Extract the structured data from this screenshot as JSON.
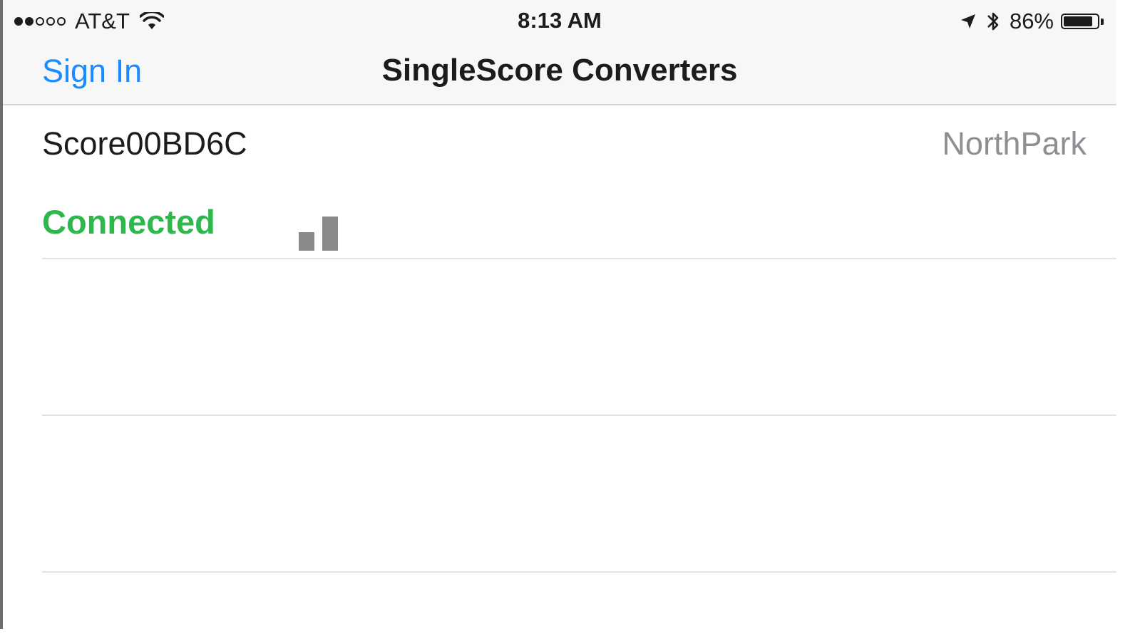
{
  "status_bar": {
    "signal_filled": 2,
    "signal_total": 5,
    "carrier": "AT&T",
    "time": "8:13 AM",
    "battery_percent": "86%",
    "battery_level": 0.86,
    "icons": [
      "wifi-icon",
      "location-arrow-icon",
      "bluetooth-icon",
      "battery-icon"
    ]
  },
  "nav": {
    "left_button": "Sign In",
    "title": "SingleScore Converters"
  },
  "devices": [
    {
      "name": "Score00BD6C",
      "location": "NorthPark",
      "status": "Connected",
      "signal_bars_visible": 2,
      "signal_icon": "signal-strength-icon"
    }
  ],
  "colors": {
    "accent": "#1a8cff",
    "connected": "#2db84b",
    "secondary_text": "#8e8e93",
    "signal_bar": "#8a8a8a"
  }
}
